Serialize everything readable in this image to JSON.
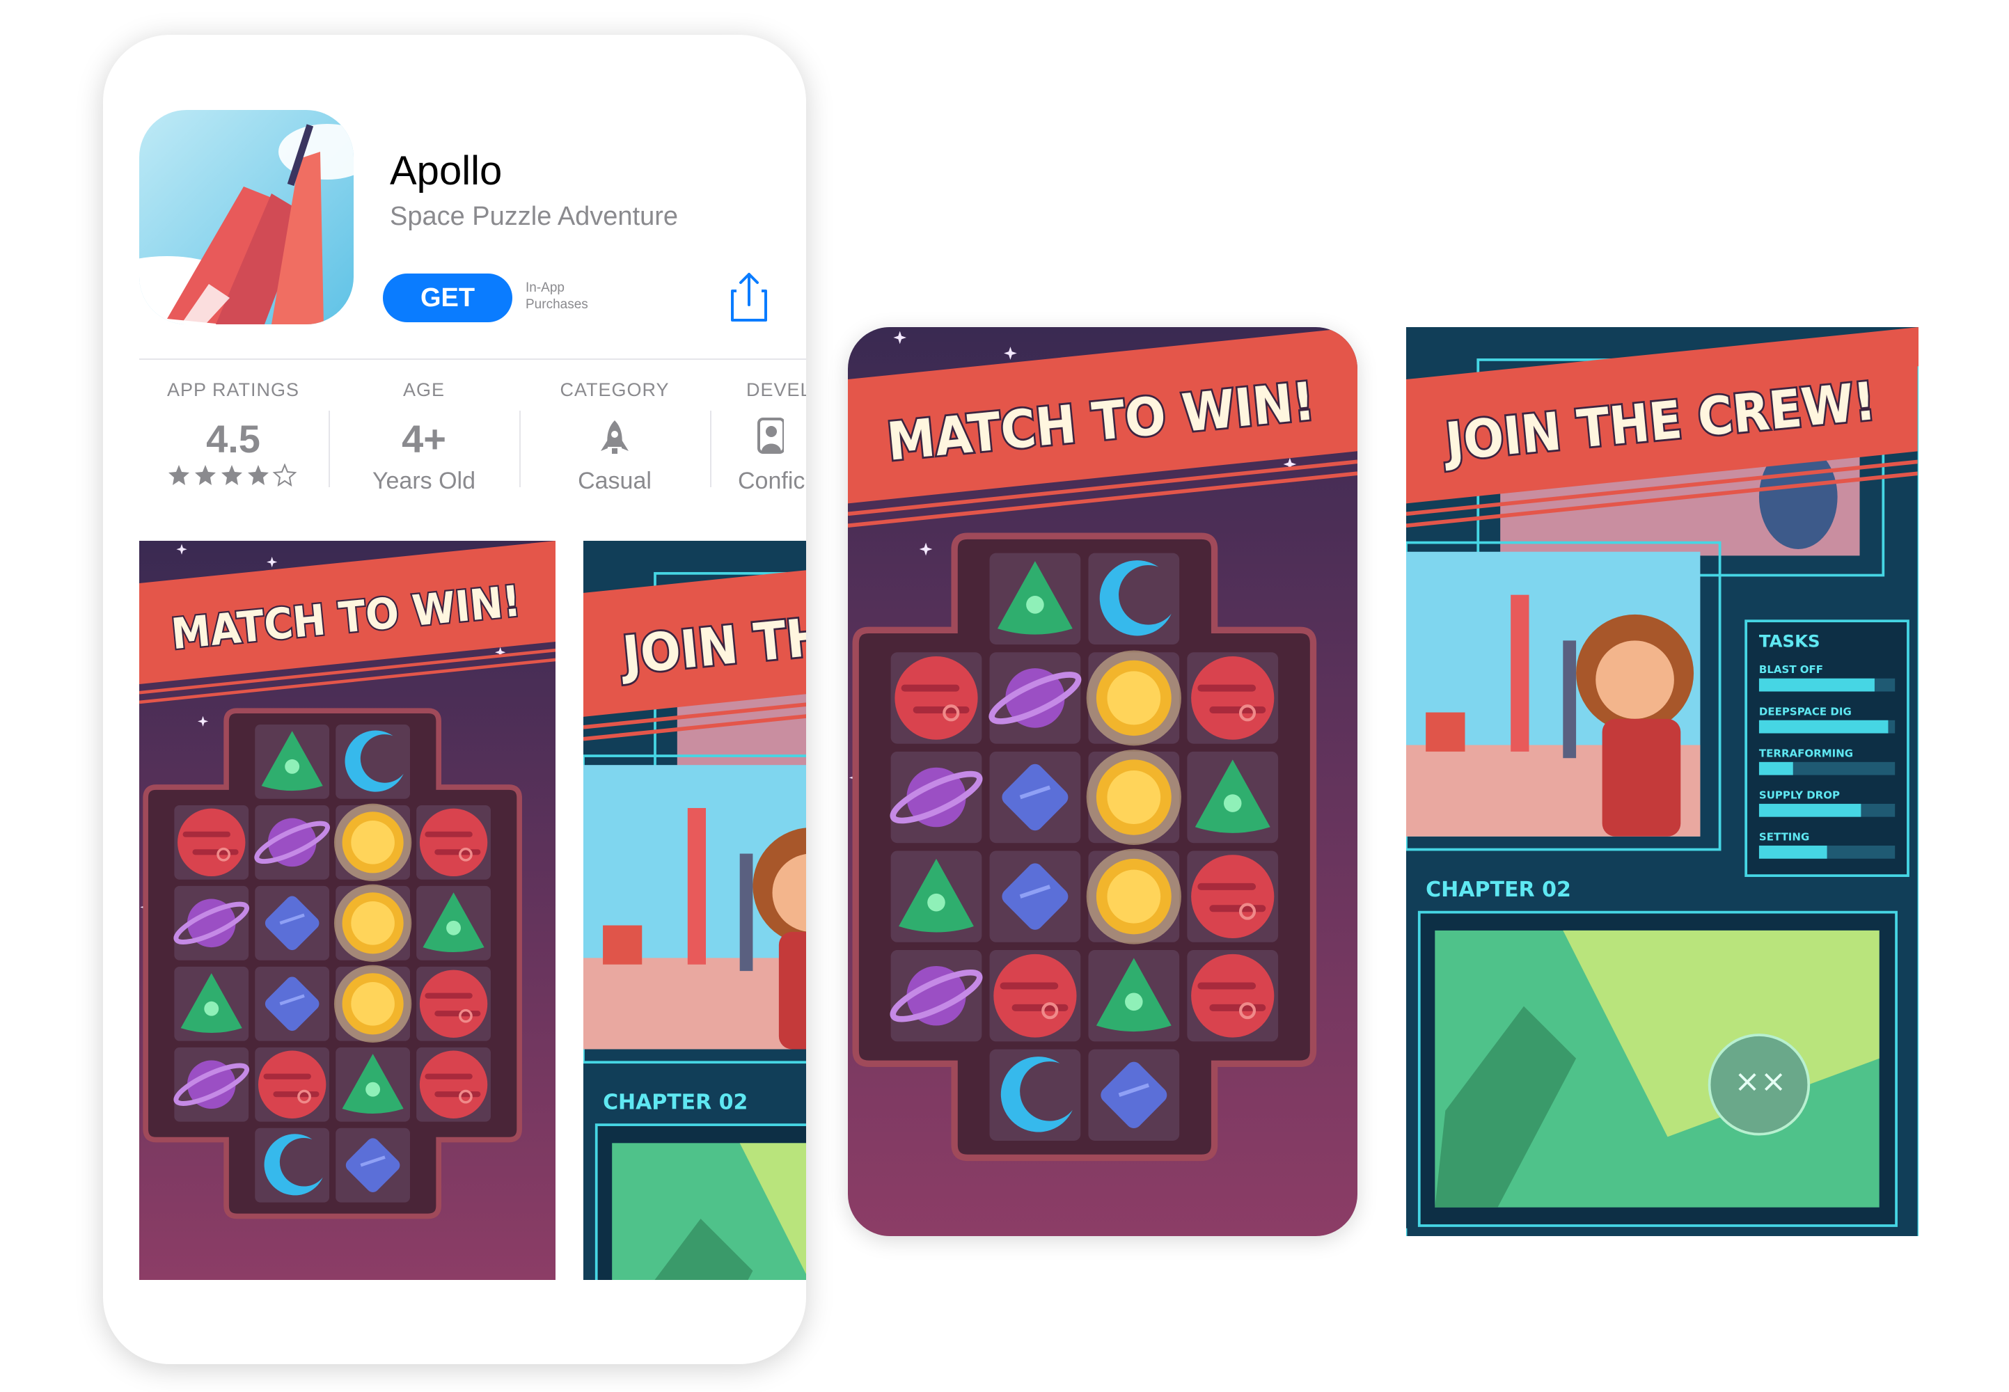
{
  "app": {
    "title": "Apollo",
    "subtitle": "Space Puzzle Adventure",
    "get_label": "GET",
    "in_app_line1": "In-App",
    "in_app_line2": "Purchases"
  },
  "info_bar": {
    "ratings": {
      "label": "APP RATINGS",
      "value": "4.5",
      "stars": 4.5
    },
    "age": {
      "label": "AGE",
      "value": "4+",
      "sub": "Years Old"
    },
    "category": {
      "label": "CATEGORY",
      "sub": "Casual",
      "icon": "rocket-icon"
    },
    "developer": {
      "label": "DEVEL",
      "sub": "Confic",
      "icon": "person-icon"
    }
  },
  "screenshots": {
    "match_banner": "MATCH TO WIN!",
    "crew_banner": "JOIN THE CREW!",
    "crew_banner_cropped": "JOIN THE",
    "chapter": "CHAPTER 02",
    "tasks_title": "TASKS",
    "tasks": [
      {
        "label": "BLAST OFF",
        "progress": 0.85
      },
      {
        "label": "DEEPSPACE DIG",
        "progress": 0.95
      },
      {
        "label": "TERRAFORMING",
        "progress": 0.25
      },
      {
        "label": "SUPPLY DROP",
        "progress": 0.75
      },
      {
        "label": "SETTING",
        "progress": 0.5
      }
    ]
  },
  "board": [
    [
      "",
      "triangle",
      "moon",
      ""
    ],
    [
      "planet",
      "saturn",
      "sun",
      "planet"
    ],
    [
      "saturn",
      "gem",
      "sun",
      "triangle"
    ],
    [
      "triangle",
      "gem",
      "sun",
      "planet"
    ],
    [
      "saturn",
      "planet",
      "triangle",
      "planet"
    ],
    [
      "",
      "moon",
      "gem",
      ""
    ]
  ],
  "colors": {
    "accent_blue": "#0a7cff",
    "banner_red": "#e4564a",
    "space_top": "#3a2a52",
    "space_bottom": "#8c3d66",
    "hud_cyan": "#46d6e4",
    "hud_dark": "#113e58"
  }
}
